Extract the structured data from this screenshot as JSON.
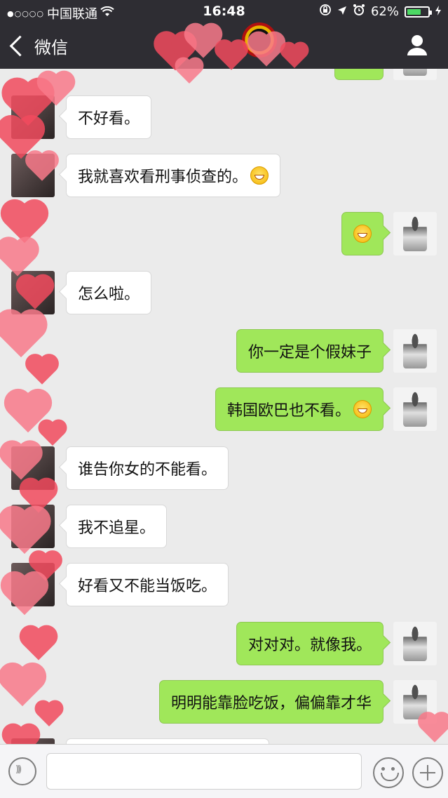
{
  "status_bar": {
    "carrier": "中国联通",
    "signal_dots": "●○○○○",
    "time": "16:48",
    "battery_percent": "62%",
    "battery_level": 0.62
  },
  "header": {
    "back_label": "微信",
    "back_icon": "chevron-left-icon",
    "profile_icon": "person-icon"
  },
  "messages": [
    {
      "side": "right",
      "text": ""
    },
    {
      "side": "left",
      "text": "不好看。"
    },
    {
      "side": "left",
      "text": "我就喜欢看刑事侦查的。",
      "emoji": "laughing-tears-emoji"
    },
    {
      "side": "right",
      "text": "",
      "emoji": "grinning-emoji"
    },
    {
      "side": "left",
      "text": "怎么啦。"
    },
    {
      "side": "right",
      "text": "你一定是个假妹子"
    },
    {
      "side": "right",
      "text": "韩国欧巴也不看。",
      "emoji": "grinning-emoji"
    },
    {
      "side": "left",
      "text": "谁告你女的不能看。"
    },
    {
      "side": "left",
      "text": "我不追星。"
    },
    {
      "side": "left",
      "text": "好看又不能当饭吃。"
    },
    {
      "side": "right",
      "text": "对对对。就像我。"
    },
    {
      "side": "right",
      "text": "明明能靠脸吃饭，偏偏靠才华"
    },
    {
      "side": "left",
      "text": ""
    }
  ],
  "input_bar": {
    "voice_icon": "voice-icon",
    "emoji_icon": "emoji-icon",
    "plus_icon": "plus-icon",
    "input_value": ""
  },
  "colors": {
    "header_bg": "#2e2d33",
    "chat_bg": "#ebebeb",
    "sent_bubble": "#a0e75a",
    "received_bubble": "#ffffff",
    "heart_red": "#f24b5e",
    "heart_pink": "#f97a8a"
  }
}
